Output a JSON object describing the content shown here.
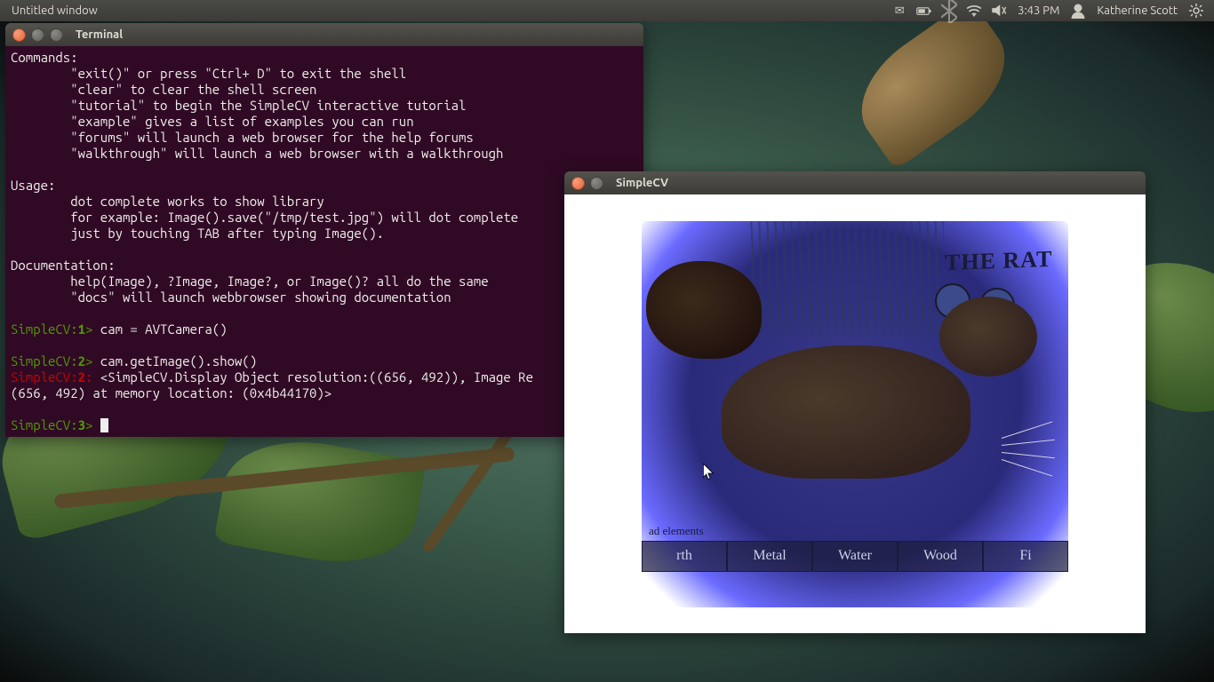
{
  "panel": {
    "app_title": "Untitled window",
    "time": "3:43 PM",
    "user": "Katherine Scott"
  },
  "terminal": {
    "title": "Terminal",
    "intro": "Commands:\n        \"exit()\" or press \"Ctrl+ D\" to exit the shell\n        \"clear\" to clear the shell screen\n        \"tutorial\" to begin the SimpleCV interactive tutorial\n        \"example\" gives a list of examples you can run\n        \"forums\" will launch a web browser for the help forums\n        \"walkthrough\" will launch a web browser with a walkthrough\n\nUsage:\n        dot complete works to show library\n        for example: Image().save(\"/tmp/test.jpg\") will dot complete\n        just by touching TAB after typing Image().\n\nDocumentation:\n        help(Image), ?Image, Image?, or Image()? all do the same\n        \"docs\" will launch webbrowser showing documentation\n",
    "p1_label": "SimpleCV:",
    "p1_num": "1",
    "p1_gt": ">",
    "p1_cmd": " cam = AVTCamera()",
    "p2_label": "SimpleCV:",
    "p2_num": "2",
    "p2_gt": ">",
    "p2_cmd": " cam.getImage().show()",
    "p2_out_label": "SimpleCV:",
    "p2_out_num": "2",
    "p2_out_colon": ":",
    "p2_out_text": " <SimpleCV.Display Object resolution:((656, 492)), Image Re",
    "p2_out_text2": "(656, 492) at memory location: (0x4b44170)>",
    "p3_label": "SimpleCV:",
    "p3_num": "3",
    "p3_gt": ">"
  },
  "image_win": {
    "title": "SimpleCV",
    "mug_title": "THE RAT",
    "subcap": "ad elements",
    "elements": [
      "rth",
      "Metal",
      "Water",
      "Wood",
      "Fi"
    ]
  }
}
